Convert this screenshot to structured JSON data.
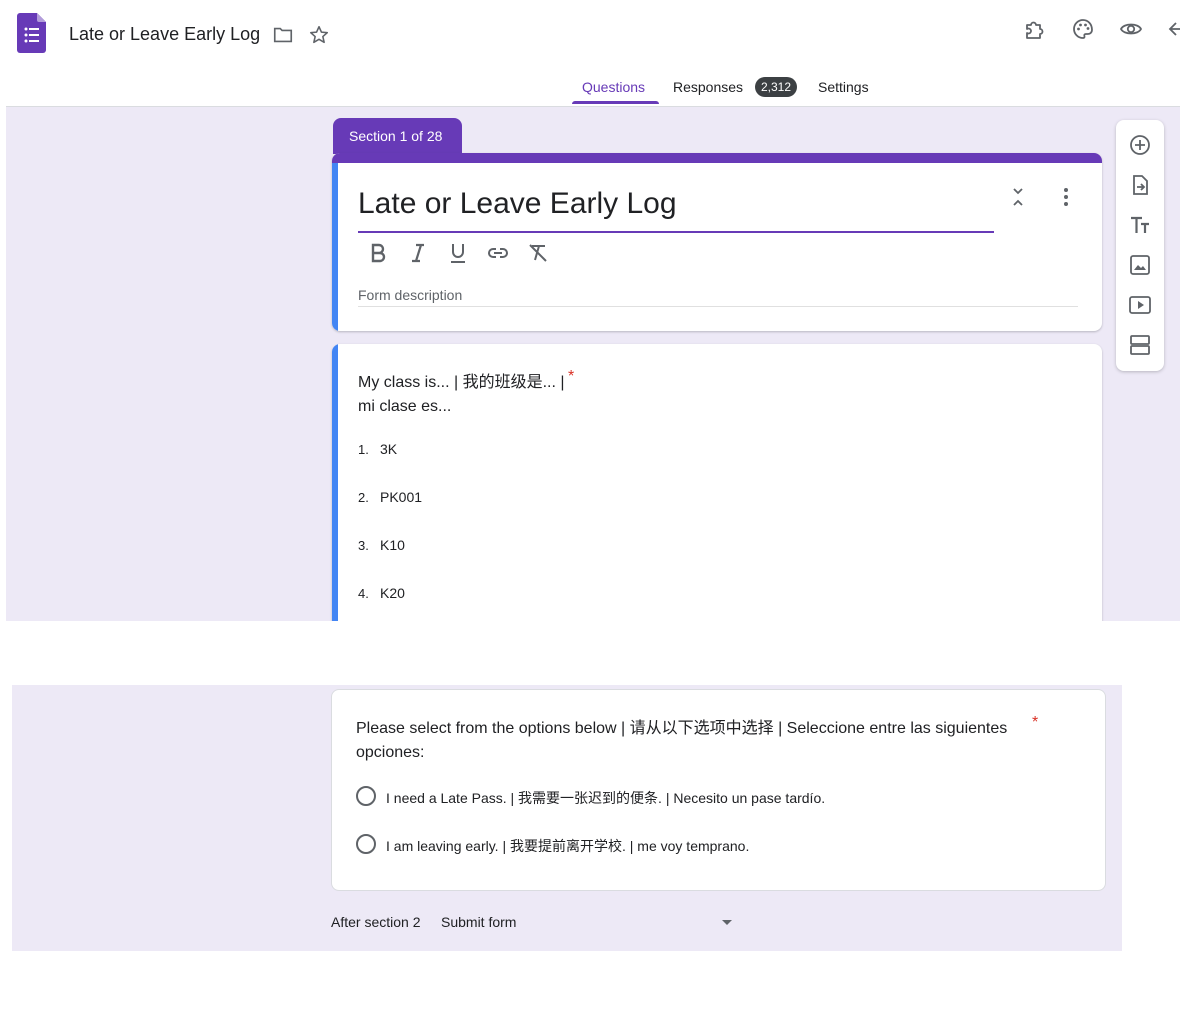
{
  "header": {
    "doc_title": "Late or Leave Early Log",
    "icons": [
      "forms-logo-icon",
      "folder-icon",
      "star-icon",
      "puzzle-addon-icon",
      "palette-icon",
      "eye-preview-icon",
      "undo-icon"
    ]
  },
  "tabs": {
    "questions": "Questions",
    "responses": "Responses",
    "responses_count": "2,312",
    "settings": "Settings",
    "active": "Questions"
  },
  "section": {
    "label": "Section 1 of 28",
    "form_title": "Late or Leave Early Log",
    "description_placeholder": "Form description",
    "format_buttons": [
      "bold-icon",
      "italic-icon",
      "underline-icon",
      "link-icon",
      "clear-format-icon"
    ]
  },
  "question1": {
    "title_line1": "My class is... | 我的班级是... |",
    "title_line2": "mi clase es...",
    "required_mark": "*",
    "options": [
      {
        "num": "1.",
        "label": "3K"
      },
      {
        "num": "2.",
        "label": "PK001"
      },
      {
        "num": "3.",
        "label": "K10"
      },
      {
        "num": "4.",
        "label": "K20"
      }
    ]
  },
  "side_toolbar": [
    "add-question-icon",
    "import-questions-icon",
    "add-title-icon",
    "add-image-icon",
    "add-video-icon",
    "add-section-icon"
  ],
  "question2": {
    "title": "Please select from the options below | 请从以下选项中选择 | Seleccione entre las siguientes opciones:",
    "required_mark": "*",
    "options": [
      "I need a Late Pass. | 我需要一张迟到的便条. | Necesito un pase tardío.",
      "I am leaving early. | 我要提前离开学校. | me voy temprano."
    ]
  },
  "after_section": {
    "label": "After section 2",
    "value": "Submit form"
  },
  "colors": {
    "brand": "#673ab7",
    "accent_blue": "#4285f4",
    "canvas": "#ede9f6",
    "required": "#d93025"
  }
}
